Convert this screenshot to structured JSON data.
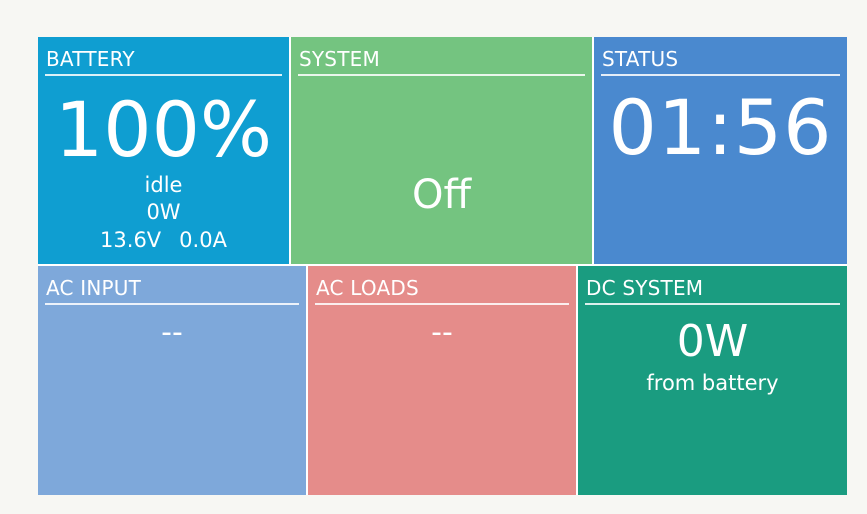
{
  "tiles": {
    "battery": {
      "title": "BATTERY",
      "percent": "100%",
      "state": "idle",
      "power": "0W",
      "voltage": "13.6V",
      "current": "0.0A",
      "color": "#0f9ed1"
    },
    "system": {
      "title": "SYSTEM",
      "value": "Off",
      "color": "#74c480"
    },
    "status": {
      "title": "STATUS",
      "time": "01:56",
      "color": "#4a89cf"
    },
    "ac_input": {
      "title": "AC INPUT",
      "value": "--",
      "color": "#7ea8da"
    },
    "ac_loads": {
      "title": "AC LOADS",
      "value": "--",
      "color": "#e58c8a"
    },
    "dc_system": {
      "title": "DC SYSTEM",
      "power": "0W",
      "subtitle": "from battery",
      "color": "#1a9c80"
    }
  }
}
